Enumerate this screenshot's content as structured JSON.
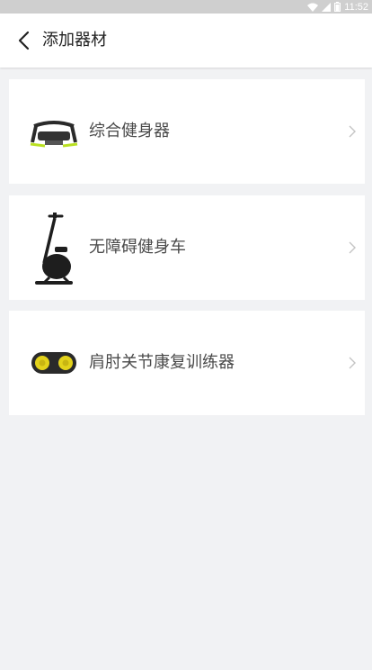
{
  "status_bar": {
    "time": "11:52",
    "icons": [
      "wifi-icon",
      "signal-icon",
      "battery-icon"
    ]
  },
  "header": {
    "title": "添加器材",
    "back_icon": "back-arrow-icon"
  },
  "equipment": [
    {
      "label": "综合健身器",
      "image": "ab-trainer-image"
    },
    {
      "label": "无障碍健身车",
      "image": "exercise-bike-image"
    },
    {
      "label": "肩肘关节康复训练器",
      "image": "shoulder-trainer-image"
    }
  ],
  "colors": {
    "background": "#f1f2f4",
    "card": "#ffffff",
    "status_bar": "#cfcfcf",
    "text": "#4a4a4a",
    "accent_yellow": "#e3d21b",
    "accent_green": "#b9e021"
  }
}
